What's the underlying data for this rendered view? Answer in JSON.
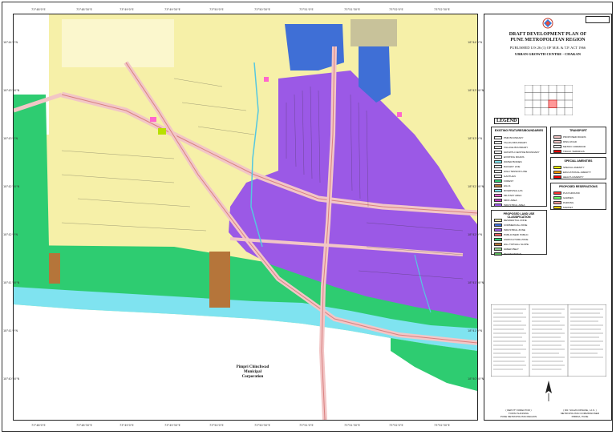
{
  "map": {
    "city_label": [
      "Pimpri Chinchwad",
      "Municipal",
      "Corporation"
    ],
    "x_ticks": [
      "73°48'0\"E",
      "73°48'30\"E",
      "73°49'0\"E",
      "73°49'30\"E",
      "73°50'0\"E",
      "73°50'30\"E",
      "73°51'0\"E",
      "73°51'30\"E",
      "73°52'0\"E",
      "73°52'30\"E"
    ],
    "y_ticks": [
      "18°44'0\"N",
      "18°43'30\"N",
      "18°43'0\"N",
      "18°42'30\"N",
      "18°42'0\"N",
      "18°41'30\"N",
      "18°41'0\"N",
      "18°40'30\"N"
    ],
    "colors": {
      "residential": "#f6f0a8",
      "commercial": "#9b59e6",
      "public": "#3f6fd6",
      "agriculture": "#2ecc71",
      "river": "#7fe3f0",
      "hill": "#b5753a",
      "road": "#f2c6c6",
      "grey_area": "#c8c29a"
    }
  },
  "panel": {
    "title_line1": "DRAFT DEVELOPMENT PLAN OF",
    "title_line2": "PUNE METROPOLITAN REGION",
    "subtitle": "PUBLISHED U/S 26 (1) OF M.R. & T.P. ACT 1966",
    "centre": "URBAN GROWTH CENTRE - CHAKAN",
    "legend_label": "LEGEND",
    "key_grid_cells": [
      "41",
      "42",
      "43",
      "44",
      "47",
      "48",
      "49",
      "50",
      "51",
      "52",
      "53",
      "54",
      "55",
      "58",
      "59",
      "60",
      "61",
      "62",
      "63",
      "64",
      "65",
      "66"
    ],
    "legend_sections": [
      {
        "heading": "EXISTING FEATURES/BOUNDARIES",
        "items": [
          {
            "label": "PMR BOUNDARY",
            "color": "#ffffff"
          },
          {
            "label": "TALUKA BOUNDARY",
            "color": "#ffffff"
          },
          {
            "label": "VILLAGE BOUNDARY",
            "color": "#ffffff"
          },
          {
            "label": "GROWTH CENTRE BOUNDARY",
            "color": "#ffffff"
          },
          {
            "label": "EXISTING ROADS",
            "color": "#ffffff"
          },
          {
            "label": "WATER BODIES",
            "color": "#7fe3f0"
          },
          {
            "label": "RAILWAY LINE",
            "color": "#ffffff"
          },
          {
            "label": "HIGH TENSION LINE",
            "color": "#ffffff"
          },
          {
            "label": "GAOTHAN",
            "color": "#ffffff"
          },
          {
            "label": "FOREST",
            "color": "#2ecc71"
          },
          {
            "label": "HILLS",
            "color": "#b5753a"
          },
          {
            "label": "RIVERS/NALLAS",
            "color": "#7fe3f0"
          },
          {
            "label": "MILITARY AREA",
            "color": "#ff66cc"
          },
          {
            "label": "MIDC AREA",
            "color": "#c040c0"
          },
          {
            "label": "INDUSTRIAL AREA",
            "color": "#9b59e6"
          }
        ]
      },
      {
        "heading": "PROPOSED LAND USE CLASSIFICATION",
        "items": [
          {
            "label": "RESIDENTIAL ZONE",
            "color": "#f6f0a8"
          },
          {
            "label": "COMMERCIAL ZONE",
            "color": "#3f6fd6"
          },
          {
            "label": "INDUSTRIAL ZONE",
            "color": "#9b59e6"
          },
          {
            "label": "PUBLIC/SEMI PUBLIC",
            "color": "#ff6666"
          },
          {
            "label": "AGRICULTURE ZONE",
            "color": "#2ecc71"
          },
          {
            "label": "HILL TOP/HILL SLOPE",
            "color": "#b5753a"
          },
          {
            "label": "GREEN BELT",
            "color": "#8fd18f"
          },
          {
            "label": "RECREATIONAL",
            "color": "#5ab55a"
          }
        ]
      },
      {
        "heading": "TRANSPORT",
        "items": [
          {
            "label": "PROPOSED ROADS",
            "color": "#f2c6c6"
          },
          {
            "label": "RING ROAD",
            "color": "#f2c6c6"
          },
          {
            "label": "METRO CORRIDOR",
            "color": "#ffffff"
          },
          {
            "label": "TRUCK TERMINUS",
            "color": "#ff0000"
          }
        ]
      },
      {
        "heading": "SPECIAL AMENITIES",
        "items": [
          {
            "label": "SPECIAL AMENITY",
            "color": "#ffff00"
          },
          {
            "label": "EDUCATIONAL AMENITY",
            "color": "#ff9900"
          },
          {
            "label": "HEALTH AMENITY",
            "color": "#ff0000"
          }
        ]
      },
      {
        "heading": "PROPOSED RESERVATIONS",
        "items": [
          {
            "label": "PLAYGROUND",
            "color": "#ff3333"
          },
          {
            "label": "GARDEN",
            "color": "#66ff66"
          },
          {
            "label": "PARKING",
            "color": "#ff9999"
          },
          {
            "label": "MARKET",
            "color": "#ffcc00"
          }
        ]
      }
    ],
    "signature_left": [
      "( DEPUTY DIRECTOR )",
      "TOWN PLANNING",
      "PUNE METROPOLITAN REGION"
    ],
    "signature_right": [
      "( DR. SUHAS DIWASE, I.A.S. )",
      "METROPOLITAN COMMISSIONER",
      "PMRDA, PUNE"
    ]
  }
}
